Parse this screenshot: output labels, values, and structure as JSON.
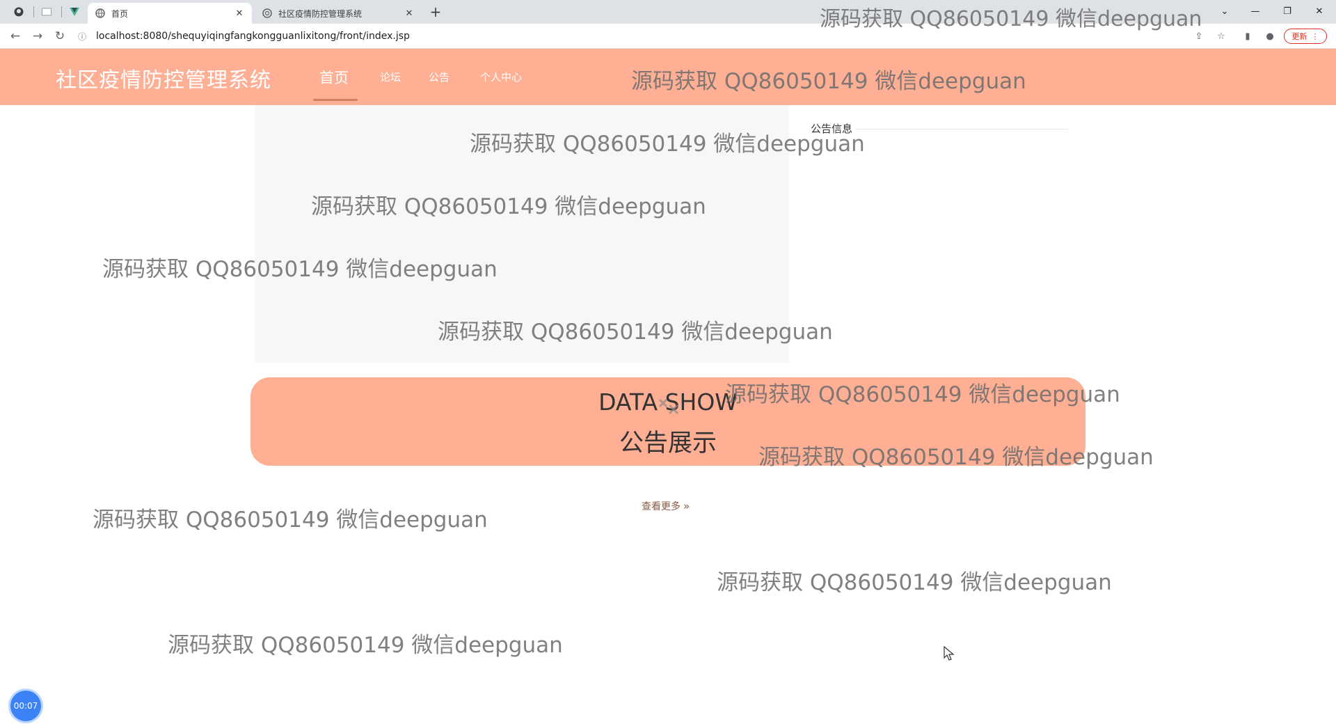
{
  "browser": {
    "tabs": [
      {
        "title": "首页"
      },
      {
        "title": "社区疫情防控管理系统"
      }
    ],
    "address": "localhost:8080/shequyiqingfangkongguanlixitong/front/index.jsp",
    "update_label": "更新"
  },
  "site": {
    "brand": "社区疫情防控管理系统",
    "nav": [
      "首页",
      "论坛",
      "公告",
      "个人中心"
    ]
  },
  "notice_heading": "公告信息",
  "banner": {
    "title_en": "DATA SHOW",
    "title_zh": "公告展示"
  },
  "more_link": "查看更多",
  "timer": "00:07",
  "watermark": "源码获取 QQ86050149 微信deepguan",
  "colors": {
    "header": "#ffaf93",
    "banner": "#ffaf93",
    "accent_underline": "#d27c61"
  }
}
